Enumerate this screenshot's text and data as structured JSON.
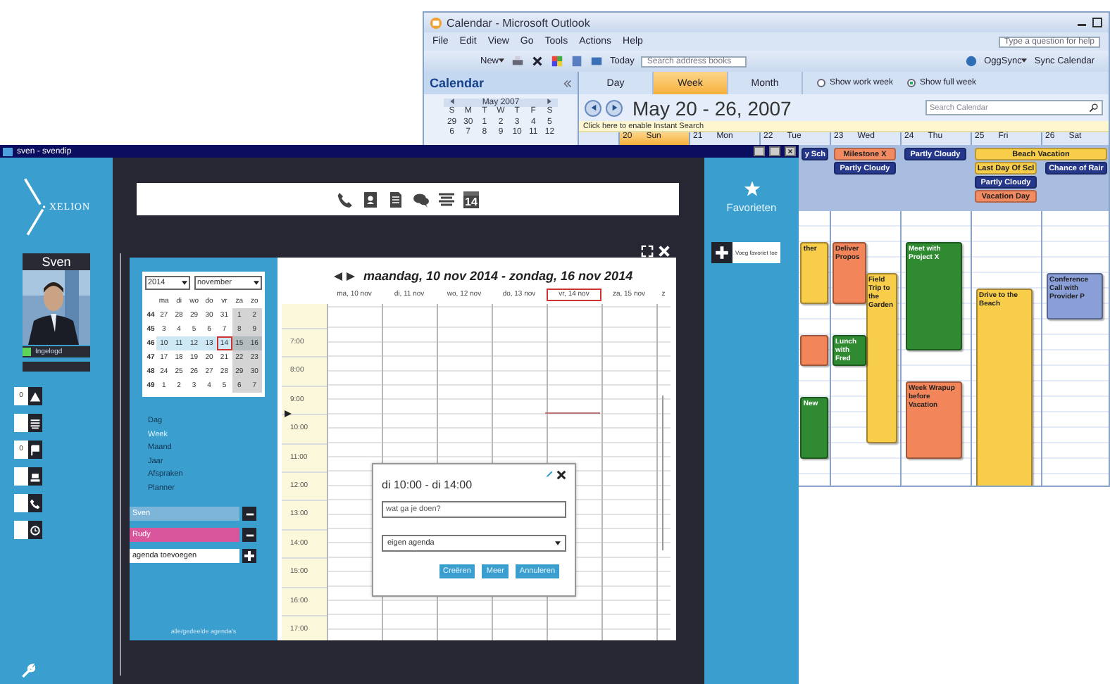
{
  "outlook": {
    "title": "Calendar - Microsoft Outlook",
    "menu": [
      "File",
      "Edit",
      "View",
      "Go",
      "Tools",
      "Actions",
      "Help"
    ],
    "help_placeholder": "Type a question for help",
    "toolbar": {
      "new": "New",
      "today": "Today",
      "address_placeholder": "Search address books",
      "sync": "OggSync",
      "sync_calendar": "Sync Calendar"
    },
    "nav_title": "Calendar",
    "mini_month": {
      "title": "May 2007",
      "weekdays": [
        "S",
        "M",
        "T",
        "W",
        "T",
        "F",
        "S"
      ],
      "weeks": [
        [
          "29",
          "30",
          "1",
          "2",
          "3",
          "4",
          "5"
        ],
        [
          "6",
          "7",
          "8",
          "9",
          "10",
          "11",
          "12"
        ]
      ]
    },
    "views": [
      {
        "label": "Day",
        "selected": false
      },
      {
        "label": "Week",
        "selected": true
      },
      {
        "label": "Month",
        "selected": false
      }
    ],
    "week_options": [
      {
        "label": "Show work week",
        "selected": false
      },
      {
        "label": "Show full week",
        "selected": true
      }
    ],
    "range": "May 20 - 26, 2007",
    "search_placeholder": "Search Calendar",
    "instant_search": "Click here to enable Instant Search",
    "days": [
      {
        "num": "20",
        "name": "Sun",
        "selected": true
      },
      {
        "num": "21",
        "name": "Mon",
        "selected": false
      },
      {
        "num": "22",
        "name": "Tue",
        "selected": false,
        "all_day": [
          {
            "text": "y Sch",
            "color": "#24378a",
            "kind": "single"
          }
        ],
        "events": [
          {
            "text": "ther",
            "color": "#f7cd4a"
          },
          {
            "color": "#f2865a"
          },
          {
            "text": "New",
            "color": "#2f8a32"
          }
        ]
      },
      {
        "num": "23",
        "name": "Wed",
        "selected": false,
        "all_day": [
          {
            "text": "Milestone X",
            "color": "#f28a62",
            "kind": "single"
          },
          {
            "text": "Partly Cloudy",
            "color": "#24378a",
            "kind": "single"
          }
        ],
        "events": [
          {
            "text": "Deliver Propos",
            "color": "#f2865a"
          },
          {
            "text": "Field Trip to the Garden",
            "color": "#f7cd4a"
          },
          {
            "text": "Lunch with Fred",
            "color": "#2f8a32"
          }
        ]
      },
      {
        "num": "24",
        "name": "Thu",
        "selected": false,
        "all_day": [
          {
            "text": "Partly Cloudy",
            "color": "#24378a",
            "kind": "single"
          }
        ],
        "events": [
          {
            "text": "Meet with Project X",
            "color": "#2f8a32"
          },
          {
            "text": "Week Wrapup before Vacation",
            "color": "#f2865a"
          }
        ]
      },
      {
        "num": "25",
        "name": "Fri",
        "selected": false,
        "all_day": [
          {
            "text": "Beach Vacation",
            "color": "#f7cd4a",
            "kind": "multi-day"
          },
          {
            "text": "Last Day Of Scl",
            "color": "#f7cd4a",
            "kind": "single"
          },
          {
            "text": "Partly Cloudy",
            "color": "#24378a",
            "kind": "single"
          },
          {
            "text": "Vacation Day",
            "color": "#f28a62",
            "kind": "single"
          }
        ],
        "events": [
          {
            "text": "Drive to the Beach",
            "color": "#f7cd4a"
          }
        ]
      },
      {
        "num": "26",
        "name": "Sat",
        "selected": false,
        "all_day": [
          {
            "text": "Chance of Rair",
            "color": "#24378a",
            "kind": "single"
          }
        ],
        "events": [
          {
            "text": "Conference Call with Provider P",
            "color": "#8a9fd8"
          }
        ]
      }
    ]
  },
  "xelion": {
    "title": "sven - svendip",
    "logo": "XELION",
    "user": {
      "name": "Sven",
      "status": "Ingelogd",
      "online": true
    },
    "side_buttons": [
      {
        "kind": "warning",
        "count": "0"
      },
      {
        "kind": "list"
      },
      {
        "kind": "flag",
        "count": "0"
      },
      {
        "kind": "contacts"
      },
      {
        "kind": "phone"
      },
      {
        "kind": "history"
      }
    ],
    "toolbar": [
      {
        "kind": "phone"
      },
      {
        "kind": "contact"
      },
      {
        "kind": "document"
      },
      {
        "kind": "chat"
      },
      {
        "kind": "list"
      },
      {
        "kind": "calendar",
        "text": "14"
      }
    ],
    "mini_calendar": {
      "year": "2014",
      "month": "november",
      "weekdays": [
        "ma",
        "di",
        "wo",
        "do",
        "vr",
        "za",
        "zo"
      ],
      "weeks": [
        {
          "num": "44",
          "selected": false,
          "days": [
            {
              "d": "27",
              "today": false
            },
            {
              "d": "28",
              "today": false
            },
            {
              "d": "29",
              "today": false
            },
            {
              "d": "30",
              "today": false
            },
            {
              "d": "31",
              "today": false
            },
            {
              "d": "1",
              "today": false
            },
            {
              "d": "2",
              "today": false
            }
          ]
        },
        {
          "num": "45",
          "selected": false,
          "days": [
            {
              "d": "3",
              "today": false
            },
            {
              "d": "4",
              "today": false
            },
            {
              "d": "5",
              "today": false
            },
            {
              "d": "6",
              "today": false
            },
            {
              "d": "7",
              "today": false
            },
            {
              "d": "8",
              "today": false
            },
            {
              "d": "9",
              "today": false
            }
          ]
        },
        {
          "num": "46",
          "selected": true,
          "days": [
            {
              "d": "10",
              "today": false
            },
            {
              "d": "11",
              "today": false
            },
            {
              "d": "12",
              "today": false
            },
            {
              "d": "13",
              "today": false
            },
            {
              "d": "14",
              "today": true
            },
            {
              "d": "15",
              "today": false
            },
            {
              "d": "16",
              "today": false
            }
          ]
        },
        {
          "num": "47",
          "selected": false,
          "days": [
            {
              "d": "17",
              "today": false
            },
            {
              "d": "18",
              "today": false
            },
            {
              "d": "19",
              "today": false
            },
            {
              "d": "20",
              "today": false
            },
            {
              "d": "21",
              "today": false
            },
            {
              "d": "22",
              "today": false
            },
            {
              "d": "23",
              "today": false
            }
          ]
        },
        {
          "num": "48",
          "selected": false,
          "days": [
            {
              "d": "24",
              "today": false
            },
            {
              "d": "25",
              "today": false
            },
            {
              "d": "26",
              "today": false
            },
            {
              "d": "27",
              "today": false
            },
            {
              "d": "28",
              "today": false
            },
            {
              "d": "29",
              "today": false
            },
            {
              "d": "30",
              "today": false
            }
          ]
        },
        {
          "num": "49",
          "selected": false,
          "days": [
            {
              "d": "1",
              "today": false
            },
            {
              "d": "2",
              "today": false
            },
            {
              "d": "3",
              "today": false
            },
            {
              "d": "4",
              "today": false
            },
            {
              "d": "5",
              "today": false
            },
            {
              "d": "6",
              "today": false
            },
            {
              "d": "7",
              "today": false
            }
          ]
        }
      ]
    },
    "views": [
      {
        "label": "Dag",
        "selected": false
      },
      {
        "label": "Week",
        "selected": true
      },
      {
        "label": "Maand",
        "selected": false
      },
      {
        "label": "Jaar",
        "selected": false
      },
      {
        "label": "Afspraken",
        "selected": false
      },
      {
        "label": "Planner",
        "selected": false
      }
    ],
    "agendas": [
      {
        "name": "Sven",
        "color": "#7db5d9"
      },
      {
        "name": "Rudy",
        "color": "#d9559c"
      }
    ],
    "add_agenda_placeholder": "agenda toevoegen",
    "footer": "alle/gedeelde agenda's",
    "range": "maandag, 10 nov 2014 - zondag, 16 nov 2014",
    "days": [
      {
        "label": "ma, 10 nov",
        "selected": false
      },
      {
        "label": "di, 11 nov",
        "selected": false
      },
      {
        "label": "wo, 12 nov",
        "selected": false
      },
      {
        "label": "do, 13 nov",
        "selected": false
      },
      {
        "label": "vr, 14 nov",
        "selected": true
      },
      {
        "label": "za, 15 nov",
        "selected": false
      },
      {
        "label": "z",
        "selected": false
      }
    ],
    "hours": [
      "7:00",
      "8:00",
      "9:00",
      "10:00",
      "11:00",
      "12:00",
      "13:00",
      "14:00",
      "15:00",
      "16:00",
      "17:00"
    ],
    "popup": {
      "title": "di 10:00 - di 14:00",
      "placeholder": "wat ga je doen?",
      "agenda": "eigen agenda",
      "buttons": [
        "Creëren",
        "Meer",
        "Annuleren"
      ]
    },
    "favorites": {
      "title": "Favorieten",
      "add": "Voeg favoriet toe"
    }
  }
}
